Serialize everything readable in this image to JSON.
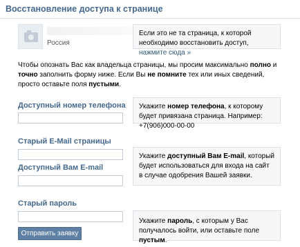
{
  "header": {
    "title": "Восстановление доступа к странице"
  },
  "profile": {
    "avatar_icon": "camera-icon",
    "country": "Россия"
  },
  "not_your_page_hint": {
    "text": "Если это не та страница, к которой необходимо восстановить доступ, ",
    "link": "нажмите сюда »"
  },
  "intro": {
    "p1": "Чтобы опознать Вас как владельца страницы, мы просим максимально ",
    "b1": "полно",
    "p2": " и ",
    "b2": "точно",
    "p3": " заполнить форму ниже. Если Вы ",
    "b3": "не помните",
    "p4": " тех или иных сведений, просто оставьте поля ",
    "b4": "пустыми",
    "p5": "."
  },
  "phone": {
    "label": "Доступный номер телефона",
    "value": "",
    "hint_p1": "Укажите ",
    "hint_b1": "номер телефона",
    "hint_p2": ", к которому будет привязана страница. Например: +7(906)000-00-00"
  },
  "old_email": {
    "label": "Старый E-Mail страницы",
    "value": ""
  },
  "current_email": {
    "label": "Доступный Вам E-mail",
    "value": "",
    "hint_p1": "Укажите ",
    "hint_b1": "доступный Вам E-mail",
    "hint_p2": ", который будет использоваться для входа на сайт в случае одобрения Вашей заявки."
  },
  "old_password": {
    "label": "Старый пароль",
    "value": "",
    "hint_p1": "Укажите ",
    "hint_b1": "пароль",
    "hint_p2": ", с которым у Вас получалось войти, или оставьте поле ",
    "hint_b2": "пустым",
    "hint_p3": "."
  },
  "submit": {
    "label": "Отправить заявку"
  },
  "colors": {
    "accent": "#45688e",
    "button": "#5e80a4",
    "hint_bg": "#f7f7f7"
  }
}
